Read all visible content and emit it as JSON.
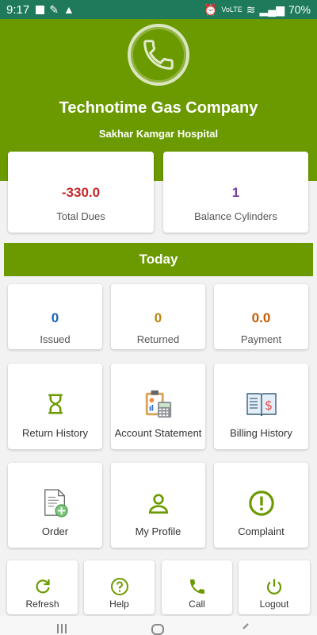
{
  "status_bar": {
    "time": "9:17",
    "network": "VoLTE",
    "battery": "70%"
  },
  "header": {
    "company_name": "Technotime Gas Company",
    "customer_name": "Sakhar Kamgar Hospital",
    "background_color": "#6b9a00"
  },
  "summary": {
    "total_dues": {
      "value": "-330.0",
      "label": "Total Dues",
      "color": "#c62828"
    },
    "balance_cylinders": {
      "value": "1",
      "label": "Balance Cylinders",
      "color": "#7b3fa0"
    }
  },
  "today": {
    "title": "Today",
    "issued": {
      "value": "0",
      "label": "Issued",
      "color": "#1565c0"
    },
    "returned": {
      "value": "0",
      "label": "Returned",
      "color": "#b8860b"
    },
    "payment": {
      "value": "0.0",
      "label": "Payment",
      "color": "#c65a00"
    }
  },
  "menu": {
    "return_history": "Return History",
    "account_statement": "Account Statement",
    "billing_history": "Billing History",
    "order": "Order",
    "my_profile": "My Profile",
    "complaint": "Complaint"
  },
  "actions": {
    "refresh": "Refresh",
    "help": "Help",
    "call": "Call",
    "logout": "Logout"
  },
  "icons": {
    "logo": "phone-icon",
    "return_history": "hourglass-icon",
    "account_statement": "clipboard-calculator-icon",
    "billing_history": "open-book-dollar-icon",
    "order": "document-add-icon",
    "my_profile": "person-icon",
    "complaint": "exclamation-circle-icon",
    "refresh": "refresh-icon",
    "help": "help-icon",
    "call": "phone-icon",
    "logout": "power-icon"
  }
}
